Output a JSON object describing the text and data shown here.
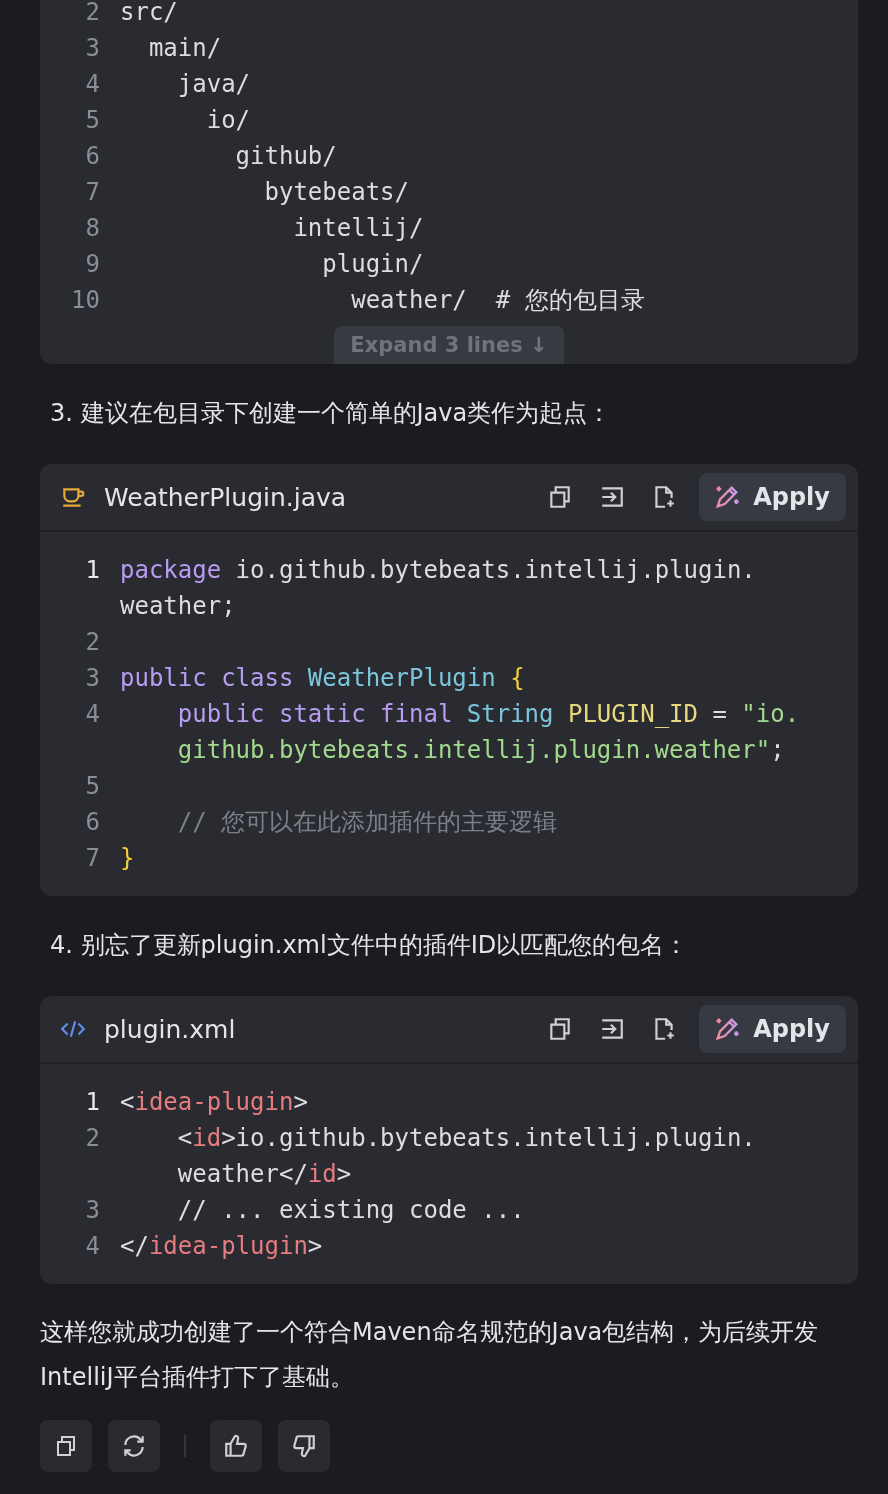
{
  "blocks": [
    {
      "kind": "code",
      "expand_label": "Expand 3 lines ↓",
      "lines": [
        {
          "number": "2",
          "current": false,
          "rows": [
            {
              "tokens": [
                {
                  "kind": "plain",
                  "text": "src/"
                }
              ]
            }
          ]
        },
        {
          "number": "3",
          "current": false,
          "rows": [
            {
              "tokens": [
                {
                  "kind": "plain",
                  "text": "  main/"
                }
              ]
            }
          ]
        },
        {
          "number": "4",
          "current": false,
          "rows": [
            {
              "tokens": [
                {
                  "kind": "plain",
                  "text": "    java/"
                }
              ]
            }
          ]
        },
        {
          "number": "5",
          "current": false,
          "rows": [
            {
              "tokens": [
                {
                  "kind": "plain",
                  "text": "      io/"
                }
              ]
            }
          ]
        },
        {
          "number": "6",
          "current": false,
          "rows": [
            {
              "tokens": [
                {
                  "kind": "plain",
                  "text": "        github/"
                }
              ]
            }
          ]
        },
        {
          "number": "7",
          "current": false,
          "rows": [
            {
              "tokens": [
                {
                  "kind": "plain",
                  "text": "          bytebeats/"
                }
              ]
            }
          ]
        },
        {
          "number": "8",
          "current": false,
          "rows": [
            {
              "tokens": [
                {
                  "kind": "plain",
                  "text": "            intellij/"
                }
              ]
            }
          ]
        },
        {
          "number": "9",
          "current": false,
          "rows": [
            {
              "tokens": [
                {
                  "kind": "plain",
                  "text": "              plugin/"
                }
              ]
            }
          ]
        },
        {
          "number": "10",
          "current": false,
          "rows": [
            {
              "tokens": [
                {
                  "kind": "plain",
                  "text": "                weather/  # 您的包目录"
                }
              ]
            }
          ]
        }
      ]
    },
    {
      "kind": "step",
      "text": "3. 建议在包目录下创建一个简单的Java类作为起点："
    },
    {
      "kind": "code",
      "header": {
        "kind": "java",
        "filename": "WeatherPlugin.java",
        "apply_label": "Apply"
      },
      "lines": [
        {
          "number": "1",
          "current": true,
          "rows": [
            {
              "tokens": [
                {
                  "kind": "keyword",
                  "text": "package"
                },
                {
                  "kind": "plain",
                  "text": " io.github.bytebeats.intellij.plugin."
                }
              ]
            },
            {
              "tokens": [
                {
                  "kind": "plain",
                  "text": "weather;"
                }
              ]
            }
          ]
        },
        {
          "number": "2",
          "current": false
        },
        {
          "number": "3",
          "current": false,
          "rows": [
            {
              "tokens": [
                {
                  "kind": "keyword",
                  "text": "public class "
                },
                {
                  "kind": "type",
                  "text": "WeatherPlugin"
                },
                {
                  "kind": "brace",
                  "text": " {"
                }
              ]
            }
          ]
        },
        {
          "number": "4",
          "current": false,
          "rows": [
            {
              "tokens": [
                {
                  "kind": "keyword",
                  "text": "    public static final "
                },
                {
                  "kind": "type",
                  "text": "String"
                },
                {
                  "kind": "const",
                  "text": " PLUGIN_ID"
                },
                {
                  "kind": "plain",
                  "text": " = "
                },
                {
                  "kind": "string",
                  "text": "\"io."
                }
              ]
            },
            {
              "tokens": [
                {
                  "kind": "string",
                  "text": "    github.bytebeats.intellij.plugin.weather\""
                },
                {
                  "kind": "plain",
                  "text": ";"
                }
              ]
            }
          ]
        },
        {
          "number": "5",
          "current": false
        },
        {
          "number": "6",
          "current": false,
          "rows": [
            {
              "tokens": [
                {
                  "kind": "comment",
                  "text": "    // 您可以在此添加插件的主要逻辑"
                }
              ]
            }
          ]
        },
        {
          "number": "7",
          "current": false,
          "rows": [
            {
              "tokens": [
                {
                  "kind": "brace",
                  "text": "}"
                }
              ]
            }
          ]
        }
      ]
    },
    {
      "kind": "step",
      "text": "4. 别忘了更新plugin.xml文件中的插件ID以匹配您的包名："
    },
    {
      "kind": "code",
      "header": {
        "kind": "xml",
        "filename": "plugin.xml",
        "apply_label": "Apply"
      },
      "lines": [
        {
          "number": "1",
          "current": true,
          "rows": [
            {
              "tokens": [
                {
                  "kind": "plain",
                  "text": "<"
                },
                {
                  "kind": "tag",
                  "text": "idea-plugin"
                },
                {
                  "kind": "plain",
                  "text": ">"
                }
              ]
            }
          ]
        },
        {
          "number": "2",
          "current": false,
          "rows": [
            {
              "tokens": [
                {
                  "kind": "plain",
                  "text": "    <"
                },
                {
                  "kind": "tag",
                  "text": "id"
                },
                {
                  "kind": "plain",
                  "text": ">io.github.bytebeats.intellij.plugin."
                }
              ]
            },
            {
              "tokens": [
                {
                  "kind": "plain",
                  "text": "    weather</"
                },
                {
                  "kind": "tag",
                  "text": "id"
                },
                {
                  "kind": "plain",
                  "text": ">"
                }
              ]
            }
          ]
        },
        {
          "number": "3",
          "current": false,
          "rows": [
            {
              "tokens": [
                {
                  "kind": "plain",
                  "text": "    // ... existing code ..."
                }
              ]
            }
          ]
        },
        {
          "number": "4",
          "current": false,
          "rows": [
            {
              "tokens": [
                {
                  "kind": "plain",
                  "text": "</"
                },
                {
                  "kind": "tag",
                  "text": "idea-plugin"
                },
                {
                  "kind": "plain",
                  "text": ">"
                }
              ]
            }
          ]
        }
      ]
    },
    {
      "kind": "paragraph",
      "text": "这样您就成功创建了一个符合Maven命名规范的Java包结构，为后续开发IntelliJ平台插件打下了基础。"
    }
  ],
  "actions": [
    {
      "kind": "copy"
    },
    {
      "kind": "regenerate"
    },
    {
      "kind": "divider"
    },
    {
      "kind": "like"
    },
    {
      "kind": "dislike"
    }
  ]
}
